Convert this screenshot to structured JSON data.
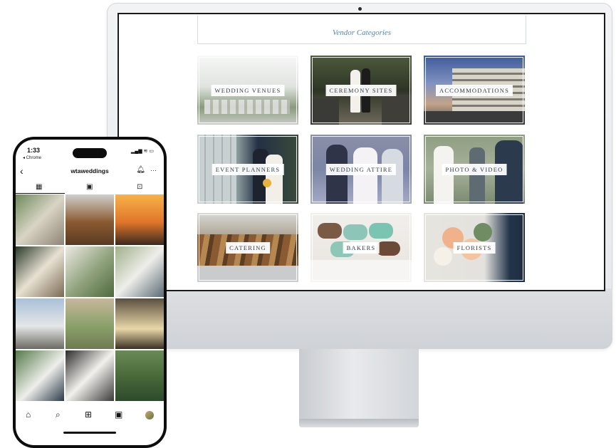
{
  "website": {
    "section_title": "Vendor Categories",
    "categories": [
      {
        "label": "WEDDING VENUES"
      },
      {
        "label": "CEREMONY SITES"
      },
      {
        "label": "ACCOMMODATIONS"
      },
      {
        "label": "EVENT PLANNERS"
      },
      {
        "label": "WEDDING ATTIRE"
      },
      {
        "label": "PHOTO & VIDEO"
      },
      {
        "label": "CATERING"
      },
      {
        "label": "BAKERS"
      },
      {
        "label": "FLORISTS"
      }
    ]
  },
  "phone": {
    "time": "1:33",
    "back_app": "◂ Chrome",
    "status_icons": "▂▄▆ ≋ ▭",
    "back_icon": "chevron-left-icon",
    "username": "wtaweddings",
    "header_icons": [
      "bell-icon",
      "more-icon"
    ],
    "profile_tabs": [
      "grid-icon",
      "reels-icon",
      "tagged-icon"
    ],
    "bottom_nav": [
      "home-icon",
      "search-icon",
      "create-icon",
      "reels-icon",
      "profile-avatar"
    ]
  },
  "colors": {
    "accent": "#5b86a8",
    "frame": "#1b1b1b"
  }
}
